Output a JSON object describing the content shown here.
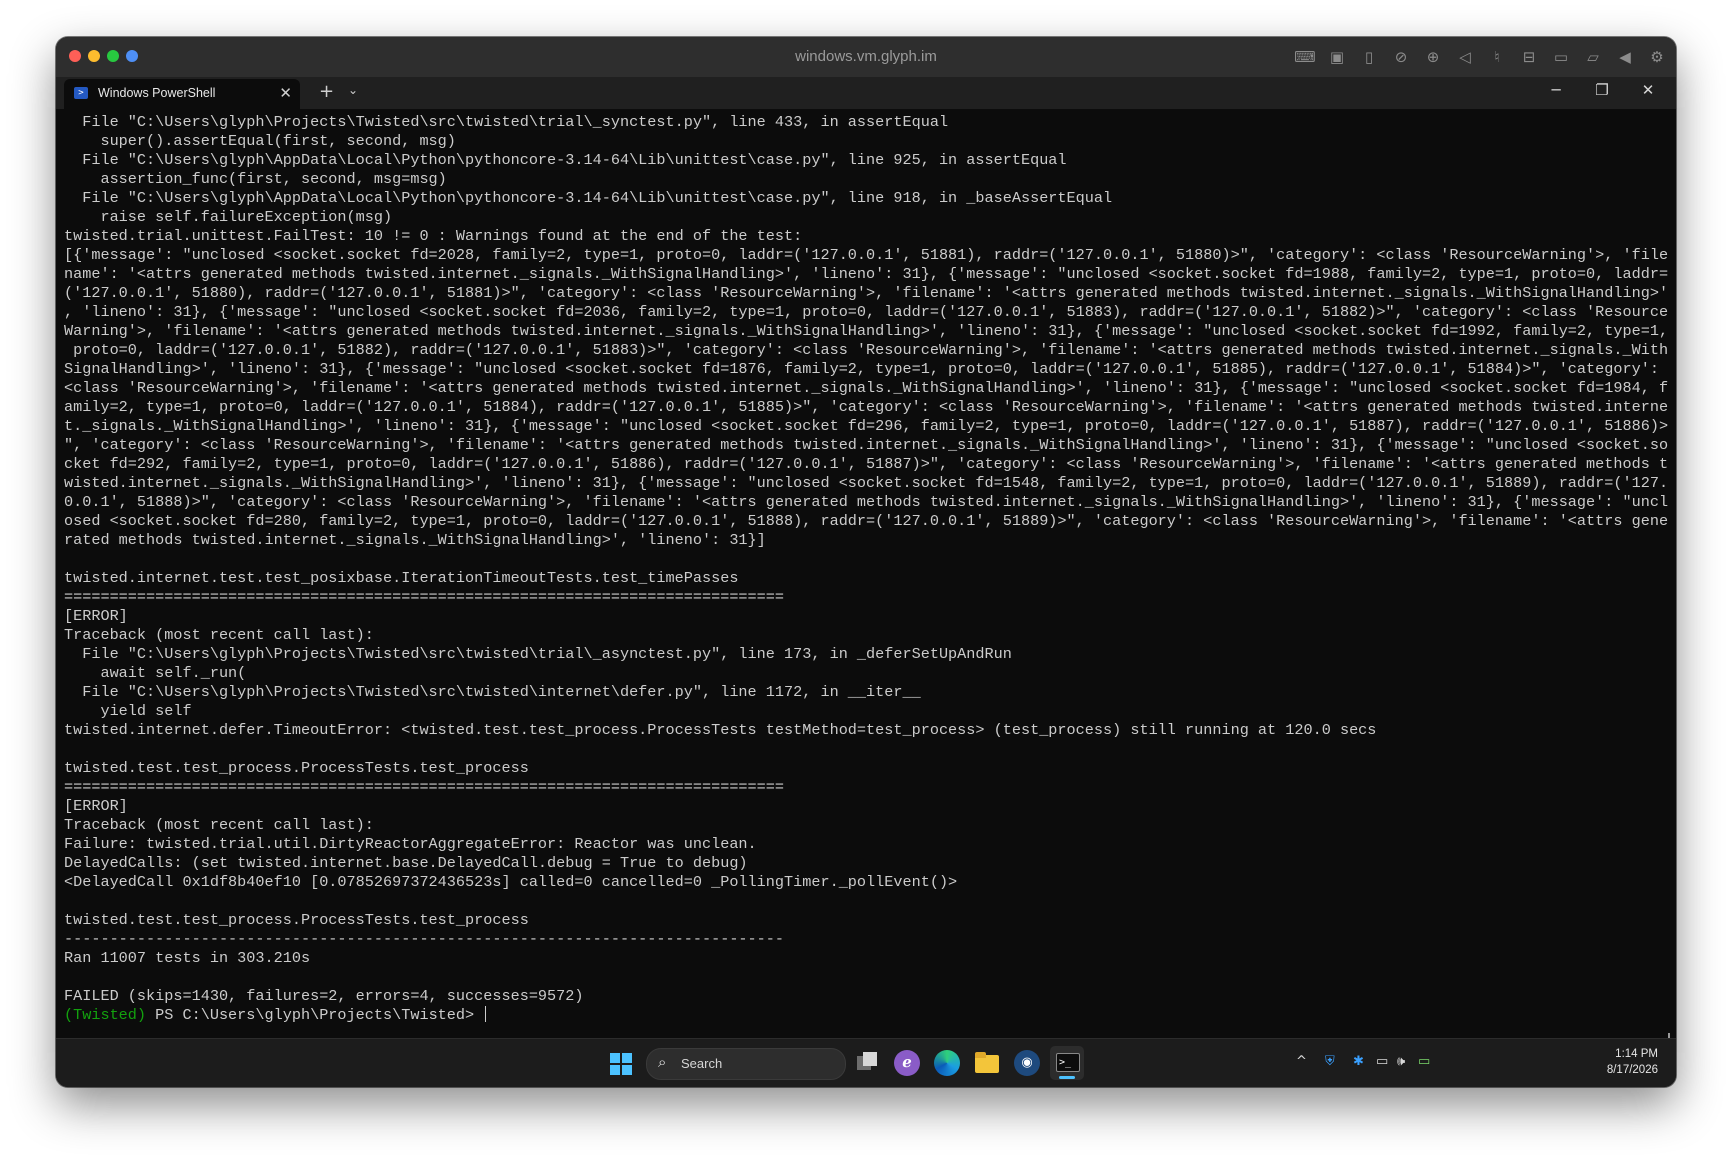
{
  "window": {
    "title": "windows.vm.glyph.im",
    "toolbar_icons": [
      "keyboard-icon",
      "chip-icon",
      "usb-icon",
      "no-camera-icon",
      "globe-icon",
      "speaker-icon",
      "microphone-icon",
      "drive-icon",
      "camera-icon",
      "folder-icon",
      "play-icon",
      "gear-icon"
    ]
  },
  "tabbar": {
    "tab_title": "Windows PowerShell",
    "close_glyph": "✕",
    "new_tab_glyph": "+",
    "dropdown_glyph": "⌄",
    "minimize_glyph": "─",
    "maximize_glyph": "❐",
    "window_close_glyph": "✕"
  },
  "terminal": {
    "lines": [
      "  File \"C:\\Users\\glyph\\Projects\\Twisted\\src\\twisted\\trial\\_synctest.py\", line 433, in assertEqual",
      "    super().assertEqual(first, second, msg)",
      "  File \"C:\\Users\\glyph\\AppData\\Local\\Python\\pythoncore-3.14-64\\Lib\\unittest\\case.py\", line 925, in assertEqual",
      "    assertion_func(first, second, msg=msg)",
      "  File \"C:\\Users\\glyph\\AppData\\Local\\Python\\pythoncore-3.14-64\\Lib\\unittest\\case.py\", line 918, in _baseAssertEqual",
      "    raise self.failureException(msg)",
      "twisted.trial.unittest.FailTest: 10 != 0 : Warnings found at the end of the test:",
      "[{'message': \"unclosed <socket.socket fd=2028, family=2, type=1, proto=0, laddr=('127.0.0.1', 51881), raddr=('127.0.0.1', 51880)>\", 'category': <class 'ResourceWarning'>, 'file",
      "name': '<attrs generated methods twisted.internet._signals._WithSignalHandling>', 'lineno': 31}, {'message': \"unclosed <socket.socket fd=1988, family=2, type=1, proto=0, laddr=",
      "('127.0.0.1', 51880), raddr=('127.0.0.1', 51881)>\", 'category': <class 'ResourceWarning'>, 'filename': '<attrs generated methods twisted.internet._signals._WithSignalHandling>'",
      ", 'lineno': 31}, {'message': \"unclosed <socket.socket fd=2036, family=2, type=1, proto=0, laddr=('127.0.0.1', 51883), raddr=('127.0.0.1', 51882)>\", 'category': <class 'Resource",
      "Warning'>, 'filename': '<attrs generated methods twisted.internet._signals._WithSignalHandling>', 'lineno': 31}, {'message': \"unclosed <socket.socket fd=1992, family=2, type=1,",
      " proto=0, laddr=('127.0.0.1', 51882), raddr=('127.0.0.1', 51883)>\", 'category': <class 'ResourceWarning'>, 'filename': '<attrs generated methods twisted.internet._signals._With",
      "SignalHandling>', 'lineno': 31}, {'message': \"unclosed <socket.socket fd=1876, family=2, type=1, proto=0, laddr=('127.0.0.1', 51885), raddr=('127.0.0.1', 51884)>\", 'category':",
      "<class 'ResourceWarning'>, 'filename': '<attrs generated methods twisted.internet._signals._WithSignalHandling>', 'lineno': 31}, {'message': \"unclosed <socket.socket fd=1984, f",
      "amily=2, type=1, proto=0, laddr=('127.0.0.1', 51884), raddr=('127.0.0.1', 51885)>\", 'category': <class 'ResourceWarning'>, 'filename': '<attrs generated methods twisted.interne",
      "t._signals._WithSignalHandling>', 'lineno': 31}, {'message': \"unclosed <socket.socket fd=296, family=2, type=1, proto=0, laddr=('127.0.0.1', 51887), raddr=('127.0.0.1', 51886)>",
      "\", 'category': <class 'ResourceWarning'>, 'filename': '<attrs generated methods twisted.internet._signals._WithSignalHandling>', 'lineno': 31}, {'message': \"unclosed <socket.so",
      "cket fd=292, family=2, type=1, proto=0, laddr=('127.0.0.1', 51886), raddr=('127.0.0.1', 51887)>\", 'category': <class 'ResourceWarning'>, 'filename': '<attrs generated methods t",
      "wisted.internet._signals._WithSignalHandling>', 'lineno': 31}, {'message': \"unclosed <socket.socket fd=1548, family=2, type=1, proto=0, laddr=('127.0.0.1', 51889), raddr=('127.",
      "0.0.1', 51888)>\", 'category': <class 'ResourceWarning'>, 'filename': '<attrs generated methods twisted.internet._signals._WithSignalHandling>', 'lineno': 31}, {'message': \"uncl",
      "osed <socket.socket fd=280, family=2, type=1, proto=0, laddr=('127.0.0.1', 51888), raddr=('127.0.0.1', 51889)>\", 'category': <class 'ResourceWarning'>, 'filename': '<attrs gene",
      "rated methods twisted.internet._signals._WithSignalHandling>', 'lineno': 31}]",
      "",
      "twisted.internet.test.test_posixbase.IterationTimeoutTests.test_timePasses",
      "===============================================================================",
      "[ERROR]",
      "Traceback (most recent call last):",
      "  File \"C:\\Users\\glyph\\Projects\\Twisted\\src\\twisted\\trial\\_asynctest.py\", line 173, in _deferSetUpAndRun",
      "    await self._run(",
      "  File \"C:\\Users\\glyph\\Projects\\Twisted\\src\\twisted\\internet\\defer.py\", line 1172, in __iter__",
      "    yield self",
      "twisted.internet.defer.TimeoutError: <twisted.test.test_process.ProcessTests testMethod=test_process> (test_process) still running at 120.0 secs",
      "",
      "twisted.test.test_process.ProcessTests.test_process",
      "===============================================================================",
      "[ERROR]",
      "Traceback (most recent call last):",
      "Failure: twisted.trial.util.DirtyReactorAggregateError: Reactor was unclean.",
      "DelayedCalls: (set twisted.internet.base.DelayedCall.debug = True to debug)",
      "<DelayedCall 0x1df8b40ef10 [0.07852697372436523s] called=0 cancelled=0 _PollingTimer._pollEvent()>",
      "",
      "twisted.test.test_process.ProcessTests.test_process",
      "-------------------------------------------------------------------------------",
      "Ran 11007 tests in 303.210s",
      "",
      "FAILED (skips=1430, failures=2, errors=4, successes=9572)"
    ],
    "prompt_env": "(Twisted)",
    "prompt_path": " PS C:\\Users\\glyph\\Projects\\Twisted> "
  },
  "taskbar": {
    "search_label": "Search",
    "search_glyph": "⌕",
    "apps": [
      "start-icon",
      "task-view-icon",
      "e-app-icon",
      "edge-icon",
      "file-explorer-icon",
      "steam-icon",
      "terminal-icon"
    ],
    "e_glyph": "ℯ",
    "steam_glyph": "◉",
    "terminal_glyph": ">_",
    "tray": {
      "chevron": "^",
      "defender": "⛨",
      "bluetooth": "✱",
      "network": "▭",
      "volume": "🕪",
      "battery": "▭"
    },
    "time": "1:14 PM",
    "date": "8/17/2026"
  }
}
